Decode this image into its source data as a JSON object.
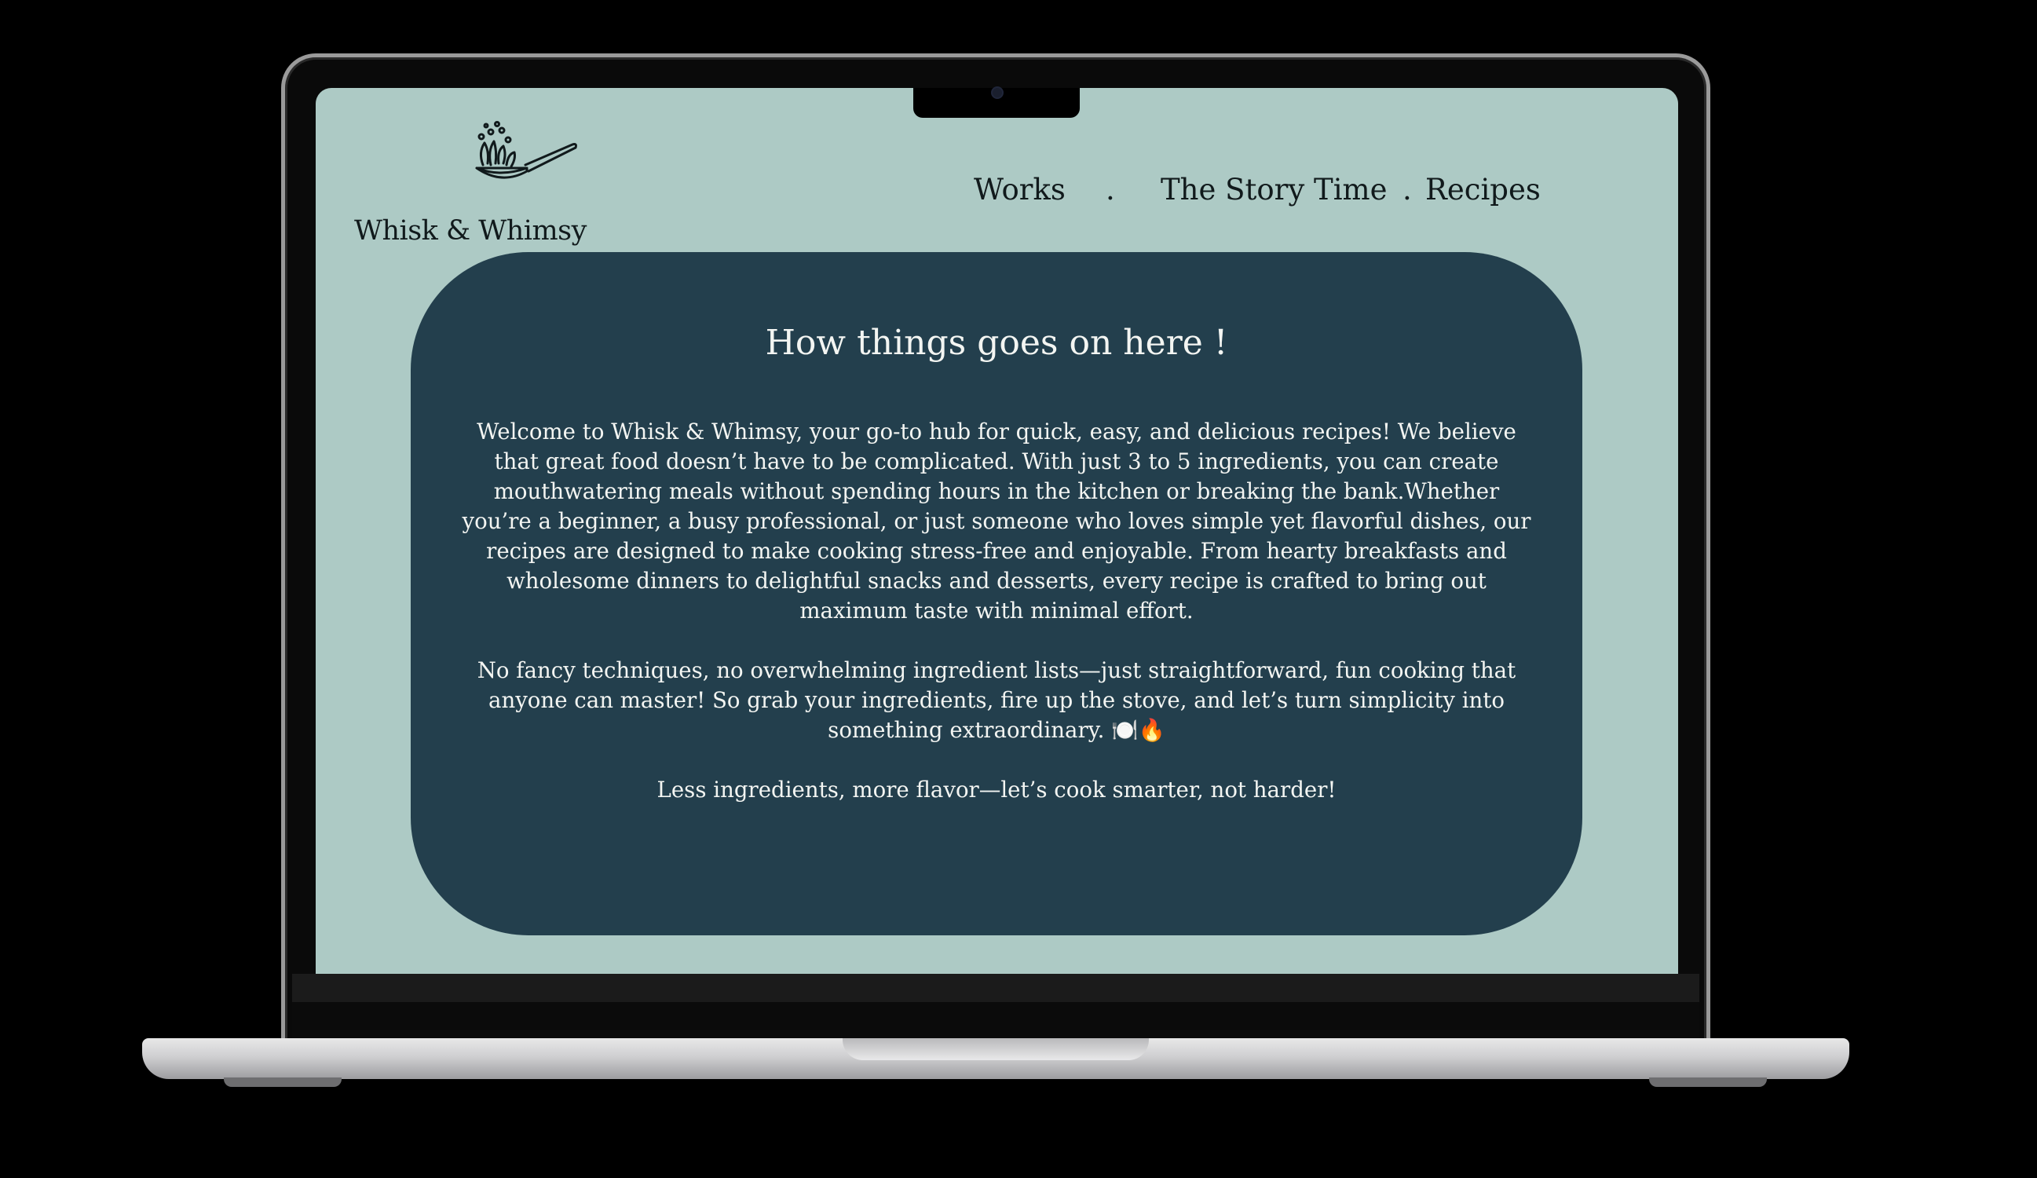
{
  "brand": {
    "name": "Whisk & Whimsy",
    "logo_icon": "whisk-pan-icon"
  },
  "nav": {
    "items": [
      {
        "label": "Works"
      },
      {
        "label": "The Story Time"
      },
      {
        "label": "Recipes"
      }
    ],
    "separator": "."
  },
  "main": {
    "title": "How things goes on  here !",
    "paragraphs": [
      "Welcome to Whisk & Whimsy, your go-to hub for quick, easy, and delicious recipes! We believe that great food doesn’t have to be complicated. With just 3 to 5 ingredients, you can create mouthwatering meals without spending hours in the kitchen or breaking the bank.Whether you’re a beginner, a busy professional, or just someone who loves simple yet flavorful dishes, our recipes are designed to make cooking stress-free and enjoyable. From hearty breakfasts and wholesome dinners to delightful snacks and desserts, every recipe is crafted to bring out maximum taste with minimal effort.",
      "No fancy techniques, no overwhelming ingredient lists—just straightforward, fun cooking that anyone can master! So grab your ingredients, fire up the stove, and let’s turn simplicity into something extraordinary. 🍽️🔥",
      "Less ingredients, more flavor—let’s cook smarter, not harder!"
    ]
  },
  "colors": {
    "page_background": "#adcac5",
    "card_background": "#233f4d",
    "card_text": "#f3f5f2",
    "nav_text": "#111a1c"
  }
}
